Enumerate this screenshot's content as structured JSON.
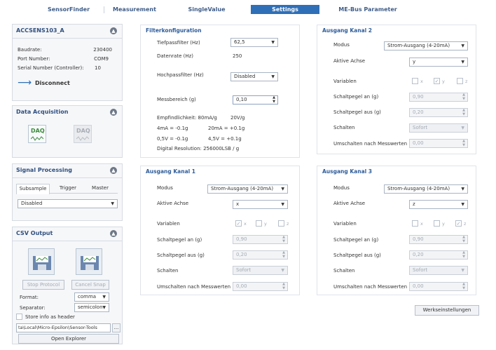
{
  "tabs": [
    {
      "label": "SensorFinder"
    },
    {
      "label": "Measurement"
    },
    {
      "label": "SingleValue"
    },
    {
      "label": "Settings"
    },
    {
      "label": "ME-Bus Parameter"
    }
  ],
  "sensor": {
    "name": "ACCSENS103_A",
    "baudrate_label": "Baudrate:",
    "baudrate_value": "230400",
    "port_label": "Port Number:",
    "port_value": "COM9",
    "serial_label": "Serial Number (Controller):",
    "serial_value": "10",
    "disconnect_label": "Disconnect"
  },
  "data_acquisition": {
    "title": "Data Acquisition",
    "icon1": "DAQ",
    "icon2": "DAQ"
  },
  "signal_processing": {
    "title": "Signal Processing",
    "tabs": [
      "Subsample",
      "Trigger",
      "Master"
    ],
    "mode_value": "Disabled"
  },
  "csv_output": {
    "title": "CSV Output",
    "stop_label": "Stop Protocol",
    "cancel_label": "Cancel Snap",
    "format_label": "Format:",
    "format_value": "comma",
    "separator_label": "Separator:",
    "separator_value": "semicolon",
    "store_header_label": "Store info as header",
    "path_value": "ta\\Local\\Micro-Epsilon\\Sensor-Tools",
    "browse_label": "...",
    "open_explorer_label": "Open Explorer"
  },
  "filter": {
    "title": "Filterkonfiguration",
    "tiefpass_label": "Tiefpassfilter (Hz)",
    "tiefpass_value": "62,5",
    "datenrate_label": "Datenrate (Hz)",
    "datenrate_value": "250",
    "hochpass_label": "Hochpassfilter (Hz)",
    "hochpass_value": "Disabled",
    "messbereich_label": "Messbereich (g)",
    "messbereich_value": "0,10",
    "empf_label": "Empfindlichkeit: 80mA/g",
    "empf_value": "20V/g",
    "line1_a": "4mA = -0.1g",
    "line1_b": "20mA = +0.1g",
    "line2_a": "0,5V = -0.1g",
    "line2_b": "4,5V = +0.1g",
    "resolution": "Digital Resolution: 256000LSB / g"
  },
  "kanal_labels": {
    "modus": "Modus",
    "achse": "Aktive Achse",
    "variablen": "Variablen",
    "an": "Schaltpegel an (g)",
    "aus": "Schaltpegel aus (g)",
    "schalten": "Schalten",
    "umschalten": "Umschalten nach Messwerten",
    "x": "x",
    "y": "y",
    "z": "z"
  },
  "kanal1": {
    "title": "Ausgang Kanal 1",
    "modus": "Strom-Ausgang (4-20mA)",
    "achse": "x",
    "an": "0,90",
    "aus": "0,20",
    "schalten": "Sofort",
    "umschalten": "0,00",
    "checked": "x"
  },
  "kanal2": {
    "title": "Ausgang Kanal 2",
    "modus": "Strom-Ausgang (4-20mA)",
    "achse": "y",
    "an": "0,90",
    "aus": "0,20",
    "schalten": "Sofort",
    "umschalten": "0,00",
    "checked": "y"
  },
  "kanal3": {
    "title": "Ausgang Kanal 3",
    "modus": "Strom-Ausgang (4-20mA)",
    "achse": "z",
    "an": "0,90",
    "aus": "0,20",
    "schalten": "Sofort",
    "umschalten": "0,00",
    "checked": "z"
  },
  "factory_reset_label": "Werkseinstellungen",
  "colors": {
    "accent": "#2f6fb7",
    "title": "#2f5d9a"
  }
}
